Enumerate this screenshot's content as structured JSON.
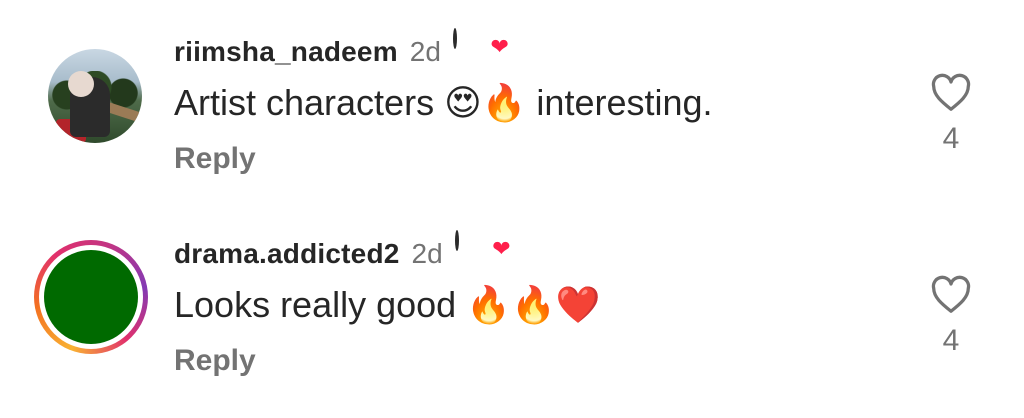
{
  "comments": [
    {
      "username": "riimsha_nadeem",
      "time": "2d",
      "text": "Artist characters 😍🔥 interesting.",
      "reply_label": "Reply",
      "likes": "4",
      "avatar": "photo",
      "badge_icon": "film-badge-icon",
      "badge_heart": "❤"
    },
    {
      "username": "drama.addicted2",
      "time": "2d",
      "text": "Looks really good 🔥🔥❤️",
      "reply_label": "Reply",
      "likes": "4",
      "avatar": "green-circle-with-story-ring",
      "badge_icon": "film-badge-icon",
      "badge_heart": "❤"
    }
  ],
  "colors": {
    "text_primary": "#262626",
    "text_secondary": "#737373",
    "avatar_green": "#006a00",
    "heart_badge": "#ff1f4b"
  },
  "icons": [
    "heart-outline-icon",
    "film-badge-icon"
  ]
}
